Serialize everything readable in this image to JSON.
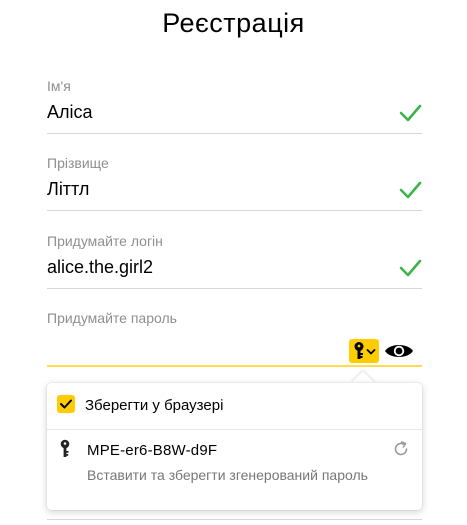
{
  "page": {
    "title": "Реєстрація"
  },
  "fields": {
    "first_name": {
      "label": "Ім'я",
      "value": "Аліса",
      "valid": true
    },
    "last_name": {
      "label": "Прізвище",
      "value": "Літтл",
      "valid": true
    },
    "login": {
      "label": "Придумайте логін",
      "value": "alice.the.girl2",
      "valid": true
    },
    "password": {
      "label": "Придумайте пароль",
      "value": ""
    }
  },
  "password_popup": {
    "save_in_browser_label": "Зберегти у браузері",
    "save_in_browser_checked": true,
    "generated_password": "MPE-er6-B8W-d9F",
    "insert_description": "Вставити та зберегти згенерований пароль"
  },
  "colors": {
    "accent": "#ffcc00",
    "valid_check": "#3cb44b",
    "label": "#8f8f8f",
    "focus_line": "#ffdb4d"
  },
  "icons": [
    "check-icon",
    "key-icon",
    "chevron-down-icon",
    "eye-icon",
    "refresh-icon"
  ]
}
